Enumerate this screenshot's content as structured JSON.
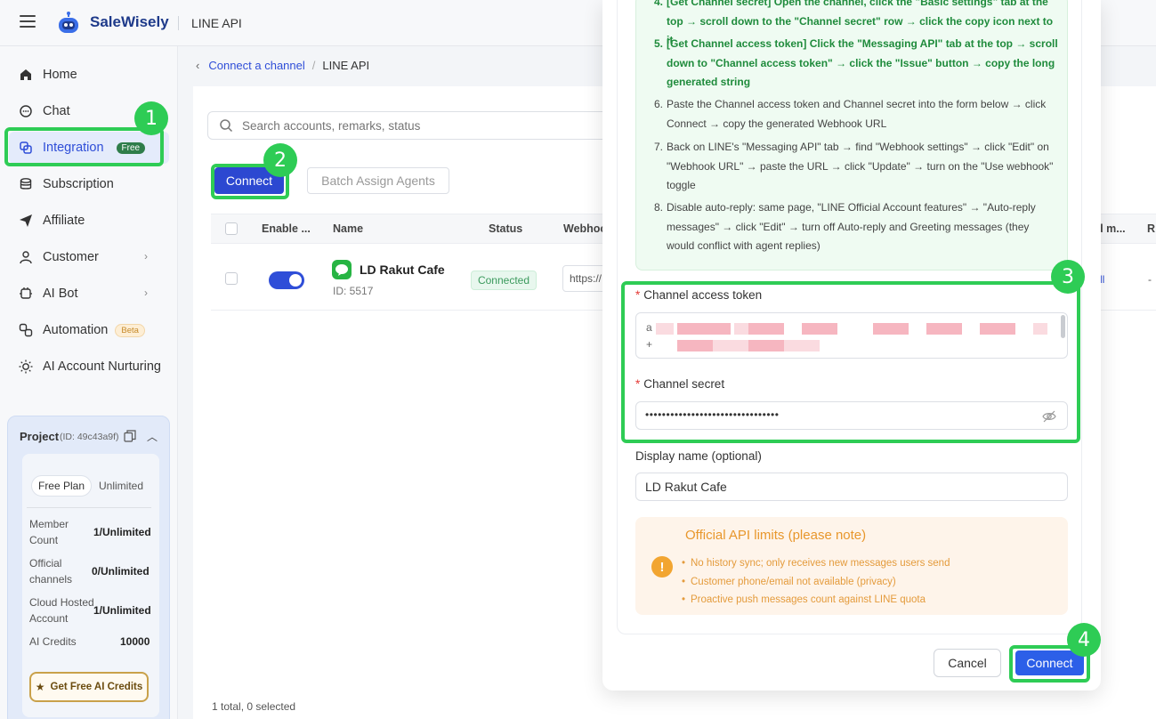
{
  "app": {
    "brand": "SaleWisely",
    "section_title": "LINE API"
  },
  "sidebar": {
    "items": [
      {
        "label": "Home",
        "icon": "home-icon"
      },
      {
        "label": "Chat",
        "icon": "chat-icon"
      },
      {
        "label": "Integration",
        "icon": "integration-icon",
        "badge": "Free"
      },
      {
        "label": "Subscription",
        "icon": "subscription-icon"
      },
      {
        "label": "Affiliate",
        "icon": "send-icon"
      },
      {
        "label": "Customer",
        "icon": "user-icon"
      },
      {
        "label": "AI Bot",
        "icon": "bot-icon"
      },
      {
        "label": "Automation",
        "icon": "automation-icon",
        "badge": "Beta"
      },
      {
        "label": "AI Account Nurturing",
        "icon": "sun-icon"
      }
    ],
    "project": {
      "title": "Project",
      "id": "(ID: 49c43a9f)",
      "plan": "Free Plan",
      "plan_limit": "Unlimited",
      "stats": [
        {
          "label": "Member Count",
          "value": "1/Unlimited"
        },
        {
          "label": "Official channels",
          "value": "0/Unlimited"
        },
        {
          "label": "Cloud Hosted Account",
          "value": "1/Unlimited"
        },
        {
          "label": "AI Credits",
          "value": "10000"
        }
      ],
      "cta": "Get Free AI Credits"
    }
  },
  "breadcrumb": {
    "parent": "Connect a channel",
    "current": "LINE API"
  },
  "toolbar": {
    "search_placeholder": "Search accounts, remarks, status",
    "connect_label": "Connect",
    "batch_label": "Batch Assign Agents"
  },
  "table": {
    "headers": {
      "enable": "Enable ...",
      "name": "Name",
      "status": "Status",
      "webhook": "Webhoo",
      "right1": "d m...",
      "right2": "R"
    },
    "rows": [
      {
        "name": "LD Rakut Cafe",
        "id": "ID: 5517",
        "status": "Connected",
        "webhook": "https://",
        "right1": "ll",
        "right2": "-"
      }
    ],
    "footer": "1 total, 0 selected"
  },
  "modal": {
    "steps": [
      {
        "num": "4.",
        "text": "[Get Channel secret] Open the channel, click the \"Basic settings\" tab at the top → scroll down to the \"Channel secret\" row → click the copy icon next to it",
        "highlight": true
      },
      {
        "num": "5.",
        "text": "[Get Channel access token] Click the \"Messaging API\" tab at the top → scroll down to \"Channel access token\" → click the \"Issue\" button → copy the long generated string",
        "highlight": true
      },
      {
        "num": "6.",
        "text": "Paste the Channel access token and Channel secret into the form below → click Connect → copy the generated Webhook URL",
        "highlight": false
      },
      {
        "num": "7.",
        "text": "Back on LINE's \"Messaging API\" tab → find \"Webhook settings\" → click \"Edit\" on \"Webhook URL\" → paste the URL → click \"Update\" → turn on the \"Use webhook\" toggle",
        "highlight": false
      },
      {
        "num": "8.",
        "text": "Disable auto-reply: same page, \"LINE Official Account features\" → \"Auto-reply messages\" → click \"Edit\" → turn off Auto-reply and Greeting messages (they would conflict with agent replies)",
        "highlight": false
      }
    ],
    "access_token_label": "Channel access token",
    "access_token_visible_start": "a",
    "access_token_line2_start": "+",
    "secret_label": "Channel secret",
    "secret_value": "••••••••••••••••••••••••••••••••",
    "display_name_label": "Display name (optional)",
    "display_name_value": "LD Rakut Cafe",
    "limits_title": "Official API limits (please note)",
    "limits": [
      "No history sync; only receives new messages users send",
      "Customer phone/email not available (privacy)",
      "Proactive push messages count against LINE quota"
    ],
    "cancel_label": "Cancel",
    "connect_label": "Connect"
  },
  "annotations": [
    "1",
    "2",
    "3",
    "4"
  ],
  "colors": {
    "brand_blue": "#2c48d1",
    "highlight_green": "#2ecc55",
    "line_green": "#27b443",
    "warning_orange": "#e8972c"
  }
}
